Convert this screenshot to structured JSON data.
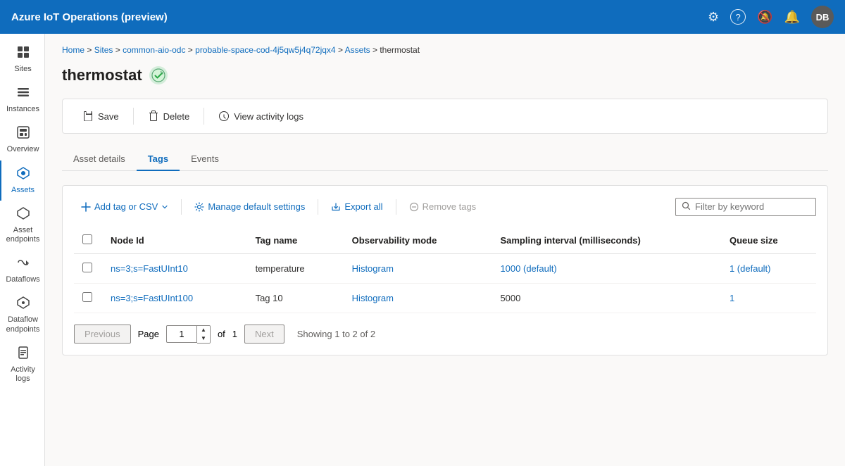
{
  "app": {
    "title": "Azure IoT Operations (preview)"
  },
  "nav_icons": {
    "settings": "⚙",
    "help": "?",
    "notifications_silent": "🔔",
    "notifications": "🔔",
    "avatar_initials": "DB"
  },
  "breadcrumb": {
    "items": [
      "Home",
      "Sites",
      "common-aio-odc",
      "probable-space-cod-4j5qw5j4q72jqx4",
      "Assets",
      "thermostat"
    ]
  },
  "page": {
    "title": "thermostat",
    "status": "connected"
  },
  "toolbar": {
    "save_label": "Save",
    "delete_label": "Delete",
    "view_activity_label": "View activity logs"
  },
  "tabs": [
    {
      "id": "asset-details",
      "label": "Asset details",
      "active": false
    },
    {
      "id": "tags",
      "label": "Tags",
      "active": true
    },
    {
      "id": "events",
      "label": "Events",
      "active": false
    }
  ],
  "tags_toolbar": {
    "add_label": "Add tag or CSV",
    "manage_label": "Manage default settings",
    "export_label": "Export all",
    "remove_label": "Remove tags",
    "filter_placeholder": "Filter by keyword"
  },
  "table": {
    "columns": [
      "Node Id",
      "Tag name",
      "Observability mode",
      "Sampling interval (milliseconds)",
      "Queue size"
    ],
    "rows": [
      {
        "node_id": "ns=3;s=FastUInt10",
        "tag_name": "temperature",
        "observability_mode": "Histogram",
        "sampling_interval": "1000 (default)",
        "queue_size": "1 (default)"
      },
      {
        "node_id": "ns=3;s=FastUInt100",
        "tag_name": "Tag 10",
        "observability_mode": "Histogram",
        "sampling_interval": "5000",
        "queue_size": "1"
      }
    ]
  },
  "pagination": {
    "previous_label": "Previous",
    "next_label": "Next",
    "page_label": "Page",
    "of_label": "of",
    "current_page": "1",
    "total_pages": "1",
    "showing_text": "Showing 1 to 2 of 2"
  },
  "sidebar": {
    "items": [
      {
        "id": "sites",
        "label": "Sites",
        "icon": "⊞",
        "active": false
      },
      {
        "id": "instances",
        "label": "Instances",
        "icon": "≡",
        "active": false
      },
      {
        "id": "overview",
        "label": "Overview",
        "icon": "▣",
        "active": false
      },
      {
        "id": "assets",
        "label": "Assets",
        "icon": "◈",
        "active": true
      },
      {
        "id": "asset-endpoints",
        "label": "Asset endpoints",
        "icon": "⬡",
        "active": false
      },
      {
        "id": "dataflows",
        "label": "Dataflows",
        "icon": "⇄",
        "active": false
      },
      {
        "id": "dataflow-endpoints",
        "label": "Dataflow endpoints",
        "icon": "⬡",
        "active": false
      },
      {
        "id": "activity-logs",
        "label": "Activity logs",
        "icon": "📋",
        "active": false
      }
    ]
  }
}
